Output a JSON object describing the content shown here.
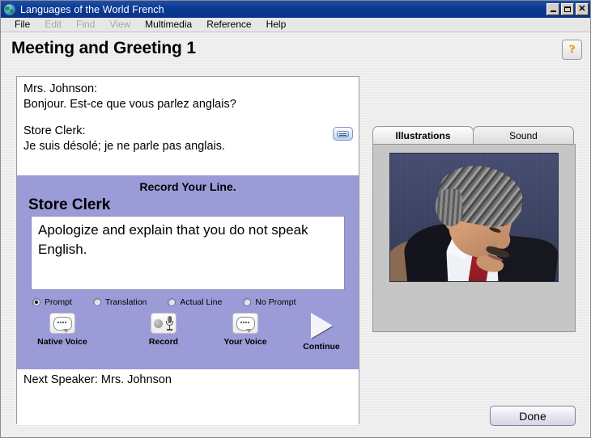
{
  "window": {
    "title": "Languages of the World  French",
    "icon": "globe-icon",
    "minimize_label": "Minimize",
    "maximize_label": "Maximize",
    "close_label": "Close"
  },
  "menubar": {
    "items": [
      {
        "label": "File",
        "disabled": false
      },
      {
        "label": "Edit",
        "disabled": true
      },
      {
        "label": "Find",
        "disabled": true
      },
      {
        "label": "View",
        "disabled": true
      },
      {
        "label": "Multimedia",
        "disabled": false
      },
      {
        "label": "Reference",
        "disabled": false
      },
      {
        "label": "Help",
        "disabled": false
      }
    ]
  },
  "header": {
    "title": "Meeting and Greeting 1",
    "help_glyph": "?"
  },
  "dialogue": {
    "lines": [
      "Mrs. Johnson:",
      "Bonjour. Est-ce que vous parlez anglais?"
    ],
    "lines2": [
      "Store Clerk:",
      "Je suis désolé; je ne parle pas anglais."
    ],
    "play_button_label": "play-line"
  },
  "record": {
    "heading": "Record Your Line.",
    "speaker": "Store Clerk",
    "prompt_text": "Apologize and explain that you do not speak English.",
    "panel_color": "#9b9bd8",
    "radios": [
      {
        "label": "Prompt",
        "selected": true
      },
      {
        "label": "Translation",
        "selected": false
      },
      {
        "label": "Actual Line",
        "selected": false
      },
      {
        "label": "No Prompt",
        "selected": false
      }
    ],
    "actions": [
      {
        "label": "Native Voice",
        "icon": "speech-bubble-icon"
      },
      {
        "label": "Record",
        "icon": "microphone-icon"
      },
      {
        "label": "Your Voice",
        "icon": "speech-bubble-icon"
      },
      {
        "label": "Continue",
        "icon": "play-triangle-icon"
      }
    ]
  },
  "next_speaker": {
    "text": "Next Speaker: Mrs. Johnson"
  },
  "media": {
    "tabs": [
      {
        "label": "Illustrations",
        "active": true
      },
      {
        "label": "Sound",
        "active": false
      }
    ],
    "illustration_alt": "Photo of a man with grey mustache wearing dark suit, white shirt and red tie",
    "panel_color": "#c6c6c6"
  },
  "footer": {
    "done_label": "Done"
  }
}
